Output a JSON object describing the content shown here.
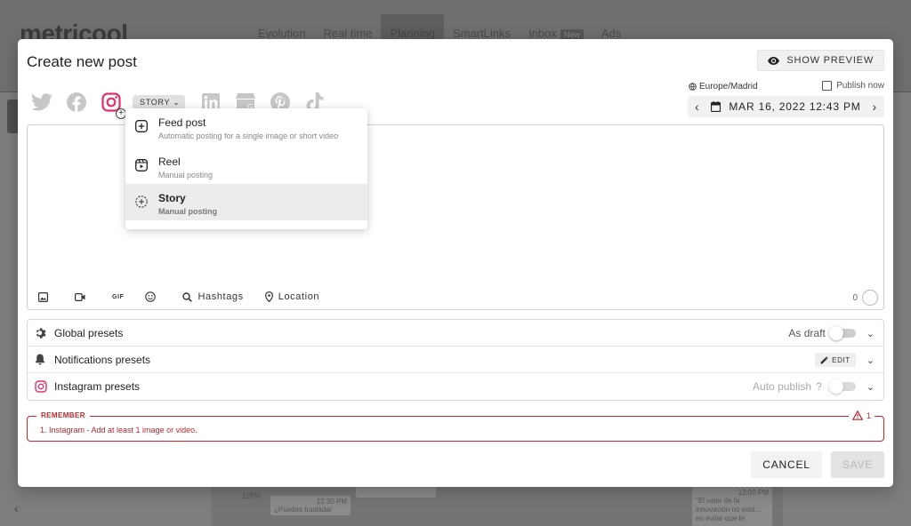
{
  "background": {
    "logo": "metricool",
    "nav": [
      {
        "label": "Evolution"
      },
      {
        "label": "Real time"
      },
      {
        "label": "Planning"
      },
      {
        "label": "SmartLinks"
      },
      {
        "label": "Inbox"
      },
      {
        "label": "Ads"
      }
    ],
    "inbox_badge": "New",
    "calendar_cards": [
      {
        "text": "12PM"
      },
      {
        "text": "12:30 PM"
      },
      {
        "text": "¿Puedes trasladar"
      },
      {
        "text": "12:00 PM"
      },
      {
        "text": "\"El valor de la innovación no está... en evitar que te"
      }
    ]
  },
  "modal": {
    "title": "Create new post",
    "show_preview_label": "SHOW PREVIEW",
    "timezone": "Europe/Madrid",
    "publish_now_label": "Publish now",
    "date": "MAR 16, 2022 12:43 PM",
    "story_pill_label": "STORY",
    "networks": [
      {
        "name": "twitter-icon"
      },
      {
        "name": "facebook-icon"
      },
      {
        "name": "instagram-icon",
        "active": true
      },
      {
        "name": "linkedin-icon"
      },
      {
        "name": "google-business-icon"
      },
      {
        "name": "pinterest-icon"
      },
      {
        "name": "tiktok-icon"
      }
    ],
    "dropdown": [
      {
        "title": "Feed post",
        "subtitle": "Automatic posting for a single image or short video",
        "icon": "plus-square-icon"
      },
      {
        "title": "Reel",
        "subtitle": "Manual posting",
        "icon": "reel-icon"
      },
      {
        "title": "Story",
        "subtitle": "Manual posting",
        "icon": "story-icon",
        "selected": true
      }
    ],
    "toolbar": {
      "gif_label": "GIF",
      "hashtags_label": "Hashtags",
      "location_label": "Location",
      "char_count": "0"
    },
    "presets": {
      "global": {
        "label": "Global presets",
        "as_draft_label": "As draft"
      },
      "notifications": {
        "label": "Notifications presets",
        "edit_label": "EDIT"
      },
      "instagram": {
        "label": "Instagram presets",
        "auto_publish_label": "Auto publish",
        "help": "?"
      }
    },
    "remember": {
      "legend": "REMEMBER",
      "count": "1",
      "message": "1. Instagram - Add at least 1 image or video."
    },
    "cancel_label": "CANCEL",
    "save_label": "SAVE",
    "colors": {
      "instagram_accent": "#e1306c",
      "error": "#c0262e"
    }
  }
}
